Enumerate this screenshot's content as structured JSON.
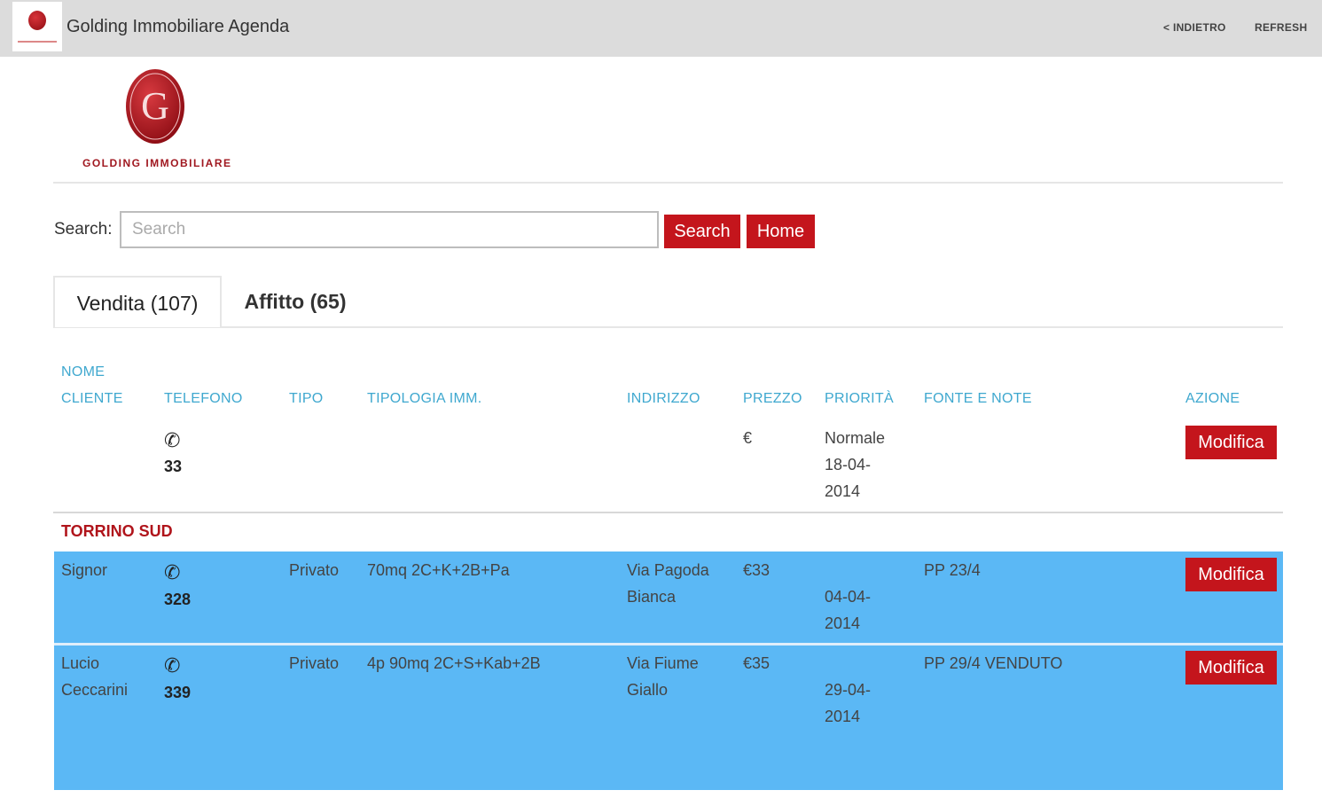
{
  "app": {
    "title": "Golding Immobiliare Agenda",
    "back_label": "< INDIETRO",
    "refresh_label": "REFRESH"
  },
  "brand": {
    "logo_text": "GOLDING IMMOBILIARE",
    "primary_color": "#c4151c",
    "accent_color": "#3fa8cf",
    "row_highlight_color": "#5bb8f5"
  },
  "search": {
    "label": "Search:",
    "placeholder": "Search",
    "value": "",
    "search_button": "Search",
    "home_button": "Home"
  },
  "tabs": [
    {
      "label": "Vendita (107)",
      "active": true
    },
    {
      "label": "Affitto (65)",
      "active": false
    }
  ],
  "table": {
    "headers": {
      "nome_line1": "NOME",
      "nome_line2": "CLIENTE",
      "telefono": "TELEFONO",
      "tipo": "TIPO",
      "tipologia": "TIPOLOGIA IMM.",
      "indirizzo": "INDIRIZZO",
      "prezzo": "PREZZO",
      "priorita": "PRIORITÀ",
      "fonte": "FONTE E NOTE",
      "azione": "AZIONE"
    },
    "first_row": {
      "phone": "33",
      "prezzo": "€",
      "priorita_line1": "Normale",
      "priorita_line2": "18-04-",
      "priorita_line3": "2014",
      "action": "Modifica"
    },
    "group_label": "TORRINO SUD",
    "rows": [
      {
        "nome_line1": "Signor",
        "nome_line2": "",
        "phone": "328",
        "tipo": "Privato",
        "tipologia": "70mq 2C+K+2B+Pa",
        "indirizzo_line1": "Via Pagoda",
        "indirizzo_line2": "Bianca",
        "prezzo": "€33",
        "priorita_line1": "04-04-",
        "priorita_line2": "2014",
        "fonte": "PP 23/4",
        "action": "Modifica"
      },
      {
        "nome_line1": "Lucio",
        "nome_line2": "Ceccarini",
        "phone": "339",
        "tipo": "Privato",
        "tipologia": "4p 90mq 2C+S+Kab+2B",
        "indirizzo_line1": "Via Fiume",
        "indirizzo_line2": "Giallo",
        "prezzo": "€35",
        "priorita_line1": "29-04-",
        "priorita_line2": "2014",
        "fonte": "PP 29/4 VENDUTO",
        "action": "Modifica"
      }
    ]
  }
}
